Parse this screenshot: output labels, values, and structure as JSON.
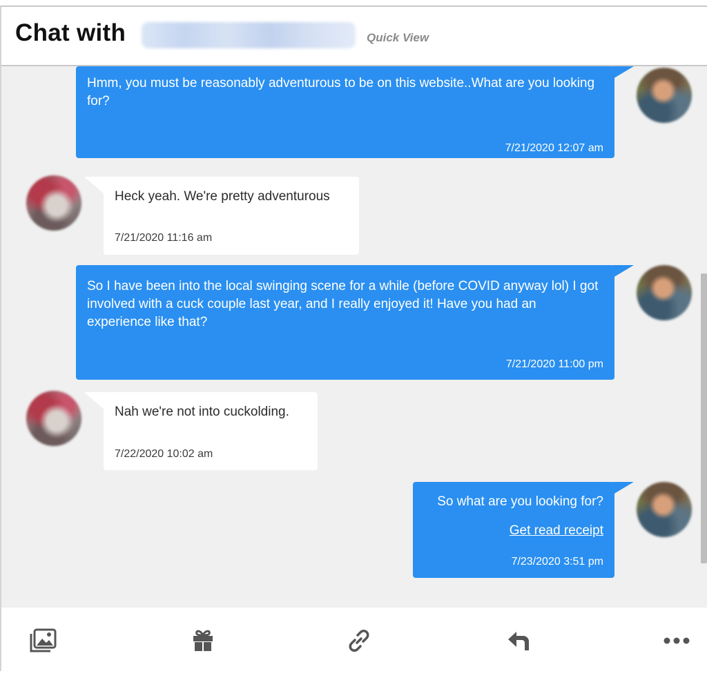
{
  "header": {
    "title": "Chat with",
    "quick_view": "Quick View"
  },
  "messages": [
    {
      "direction": "outgoing",
      "text": "Hmm, you must be reasonably adventurous to be on this website..What are you looking for?",
      "time": "7/21/2020 12:07 am"
    },
    {
      "direction": "incoming",
      "text": "Heck yeah. We're pretty adventurous",
      "time": "7/21/2020 11:16 am"
    },
    {
      "direction": "outgoing",
      "text": "So I have been into the local swinging scene for a while (before COVID anyway lol) I got involved with a cuck couple last year, and I really enjoyed it! Have you had an experience like that?",
      "time": "7/21/2020 11:00 pm"
    },
    {
      "direction": "incoming",
      "text": "Nah we're not into cuckolding.",
      "time": "7/22/2020 10:02 am"
    },
    {
      "direction": "outgoing",
      "text": "So what are you looking for?",
      "link": "Get read receipt",
      "time": "7/23/2020 3:51 pm"
    }
  ],
  "toolbar": {
    "icons": [
      "photo-gallery-icon",
      "gift-icon",
      "link-icon",
      "reply-icon",
      "more-options-icon"
    ]
  },
  "colors": {
    "outgoing_bubble": "#2a8ff0",
    "incoming_bubble": "#ffffff",
    "background": "#f0f0f0",
    "icon": "#555555"
  }
}
